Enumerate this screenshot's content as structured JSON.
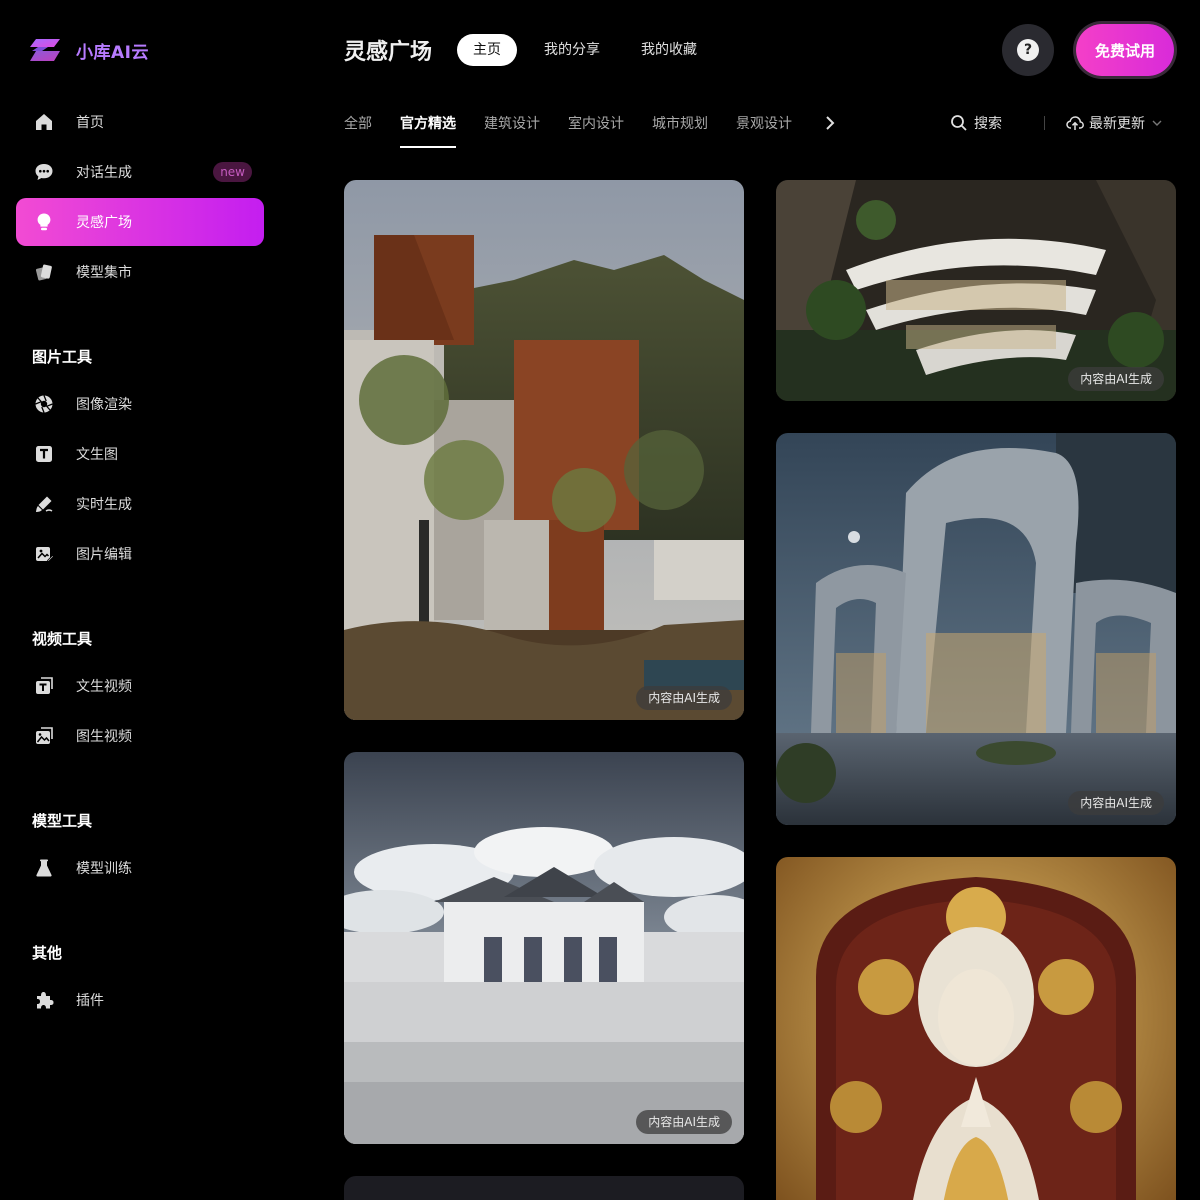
{
  "brand": {
    "name": "小库AI云",
    "logo_icon": "logo-icon"
  },
  "sidebar": {
    "main_items": [
      {
        "label": "首页",
        "icon": "home-icon"
      },
      {
        "label": "对话生成",
        "icon": "chat-icon",
        "badge": "new"
      },
      {
        "label": "灵感广场",
        "icon": "lightbulb-icon",
        "active": true
      },
      {
        "label": "模型集市",
        "icon": "model-market-icon"
      }
    ],
    "sections": [
      {
        "title": "图片工具",
        "items": [
          {
            "label": "图像渲染",
            "icon": "aperture-icon"
          },
          {
            "label": "文生图",
            "icon": "text-image-icon"
          },
          {
            "label": "实时生成",
            "icon": "brush-icon"
          },
          {
            "label": "图片编辑",
            "icon": "image-edit-icon"
          }
        ]
      },
      {
        "title": "视频工具",
        "items": [
          {
            "label": "文生视频",
            "icon": "text-video-icon"
          },
          {
            "label": "图生视频",
            "icon": "image-video-icon"
          }
        ]
      },
      {
        "title": "模型工具",
        "items": [
          {
            "label": "模型训练",
            "icon": "flask-icon"
          }
        ]
      },
      {
        "title": "其他",
        "items": [
          {
            "label": "插件",
            "icon": "puzzle-icon"
          }
        ]
      }
    ]
  },
  "header": {
    "title": "灵感广场",
    "tabs": [
      {
        "label": "主页",
        "active": true
      },
      {
        "label": "我的分享"
      },
      {
        "label": "我的收藏"
      }
    ],
    "help_label": "?",
    "trial_label": "免费试用"
  },
  "categories": {
    "items": [
      "全部",
      "官方精选",
      "建筑设计",
      "室内设计",
      "城市规划",
      "景观设计"
    ],
    "active": "官方精选",
    "search_label": "搜索",
    "sort_label": "最新更新"
  },
  "cards": [
    {
      "subject": "corten-steel-villa",
      "tag": "内容由AI生成"
    },
    {
      "subject": "white-palace",
      "tag": "内容由AI生成"
    },
    {
      "subject": "cliff-terrace-building",
      "tag": "内容由AI生成"
    },
    {
      "subject": "futuristic-arch-pavilion",
      "tag": "内容由AI生成"
    },
    {
      "subject": "baroque-madonna"
    }
  ],
  "colors": {
    "accent_start": "#f24bd3",
    "accent_end": "#c41ef0",
    "brand": "#b77bff",
    "background": "#000000"
  }
}
